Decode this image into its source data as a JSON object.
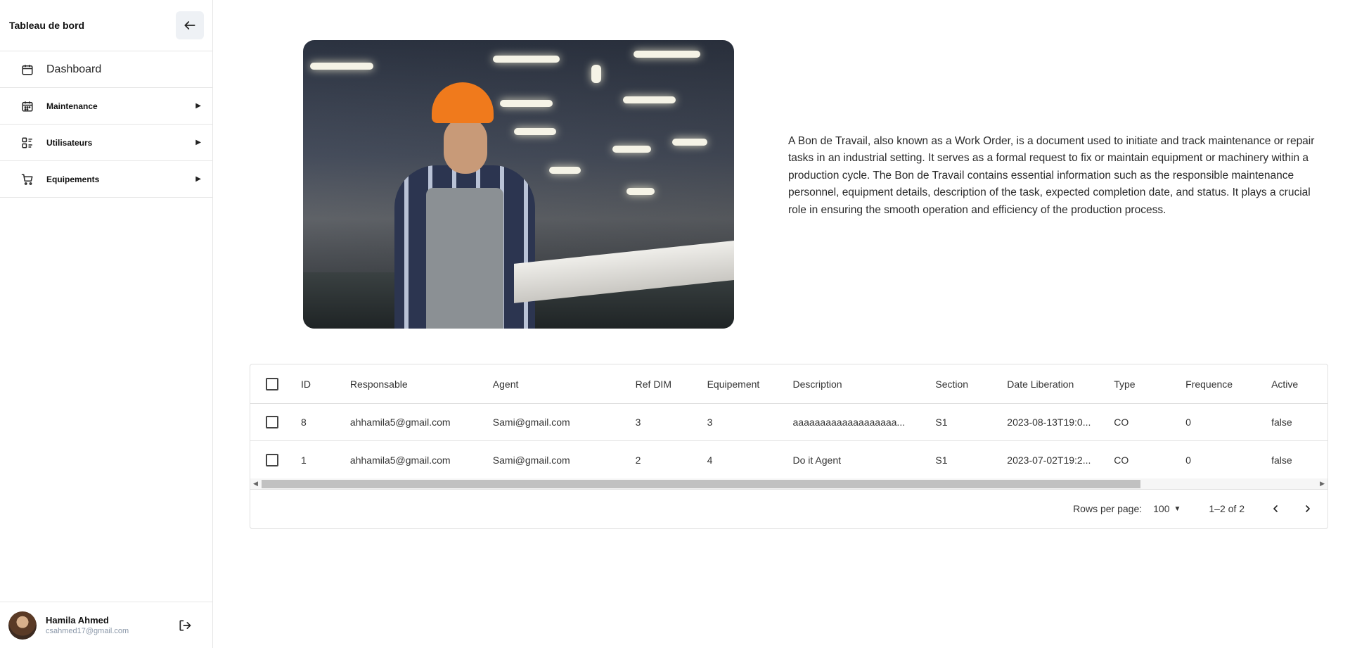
{
  "sidebar": {
    "title": "Tableau de bord",
    "items": [
      {
        "label": "Dashboard",
        "icon": "calendar-icon"
      },
      {
        "label": "Maintenance",
        "icon": "calendar-grid-icon"
      },
      {
        "label": "Utilisateurs",
        "icon": "user-list-icon"
      },
      {
        "label": "Equipements",
        "icon": "cart-icon"
      }
    ],
    "user": {
      "name": "Hamila Ahmed",
      "email": "csahmed17@gmail.com"
    }
  },
  "main": {
    "description": "A Bon de Travail, also known as a Work Order, is a document used to initiate and track maintenance or repair tasks in an industrial setting. It serves as a formal request to fix or maintain equipment or machinery within a production cycle. The Bon de Travail contains essential information such as the responsible maintenance personnel, equipment details, description of the task, expected completion date, and status. It plays a crucial role in ensuring the smooth operation and efficiency of the production process."
  },
  "table": {
    "columns": [
      "ID",
      "Responsable",
      "Agent",
      "Ref DIM",
      "Equipement",
      "Description",
      "Section",
      "Date Liberation",
      "Type",
      "Frequence",
      "Active"
    ],
    "rows": [
      [
        "8",
        "ahhamila5@gmail.com",
        "Sami@gmail.com",
        "3",
        "3",
        "aaaaaaaaaaaaaaaaaaa...",
        "S1",
        "2023-08-13T19:0...",
        "CO",
        "0",
        "false"
      ],
      [
        "1",
        "ahhamila5@gmail.com",
        "Sami@gmail.com",
        "2",
        "4",
        "Do it Agent",
        "S1",
        "2023-07-02T19:2...",
        "CO",
        "0",
        "false"
      ]
    ],
    "footer": {
      "rows_per_page_label": "Rows per page:",
      "rows_per_page_value": "100",
      "range": "1–2 of 2"
    }
  }
}
